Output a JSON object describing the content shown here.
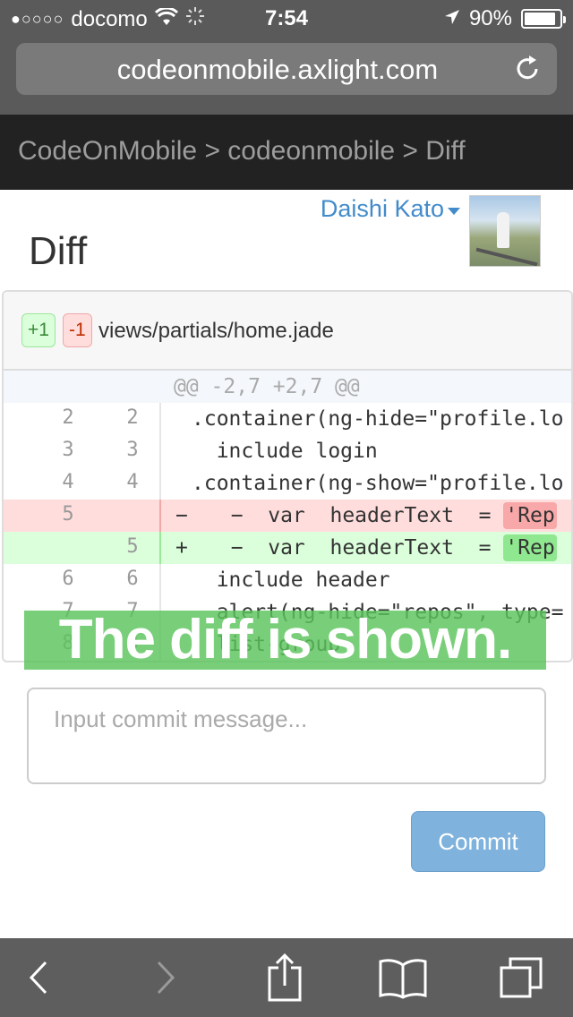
{
  "status_bar": {
    "signal": "●○○○○",
    "carrier": "docomo",
    "time": "7:54",
    "battery": "90%",
    "battery_level": 0.9
  },
  "browser": {
    "url": "codeonmobile.axlight.com"
  },
  "breadcrumb": "CodeOnMobile > codeonmobile > Diff",
  "user": {
    "name": "Daishi Kato"
  },
  "page": {
    "title": "Diff"
  },
  "diff": {
    "additions": "+1",
    "deletions": "-1",
    "file": "views/partials/home.jade",
    "hunk": "@@ -2,7 +2,7 @@",
    "rows": [
      {
        "old": "2",
        "new": "2",
        "code": ".container(ng-hide=\"profile.lo"
      },
      {
        "old": "3",
        "new": "3",
        "code": "  include login"
      },
      {
        "old": "4",
        "new": "4",
        "code": ".container(ng-show=\"profile.lo"
      },
      {
        "old": "5",
        "new": "",
        "sign": "−",
        "code": "  −  var  headerText  = ",
        "hl": "'Rep"
      },
      {
        "old": "",
        "new": "5",
        "sign": "+",
        "code": "  −  var  headerText  = ",
        "hl": "'Rep"
      },
      {
        "old": "6",
        "new": "6",
        "code": "  include header"
      },
      {
        "old": "7",
        "new": "7",
        "code": "  alert(ng-hide=\"repos\", type="
      },
      {
        "old": "8",
        "new": "8",
        "code": "  list-group"
      }
    ]
  },
  "caption": "The diff is shown.",
  "commit": {
    "placeholder": "Input commit message...",
    "button": "Commit"
  },
  "colors": {
    "accent": "#428bca",
    "navbar": "#222222",
    "added": "#dbffdb",
    "removed": "#ffdddd",
    "caption_bg": "#5cc45c"
  }
}
